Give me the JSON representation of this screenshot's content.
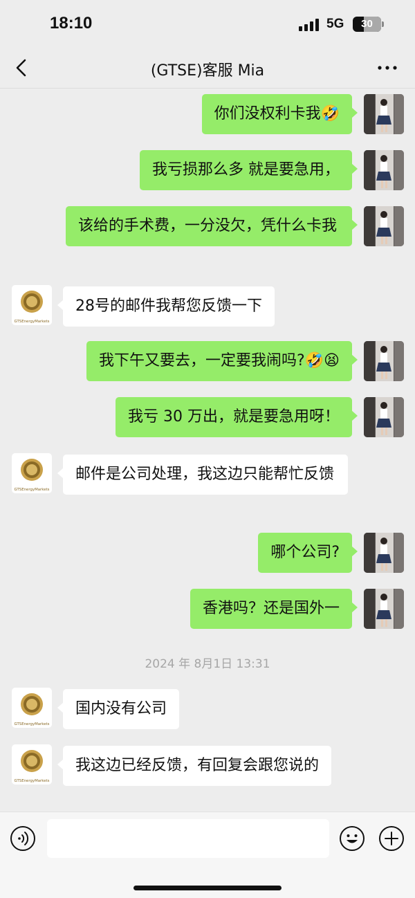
{
  "status_bar": {
    "time": "18:10",
    "network": "5G",
    "battery": "30"
  },
  "header": {
    "title": "(GTSE)客服  Mia",
    "back_icon": "chevron-left-icon",
    "more_icon": "more-dots-icon"
  },
  "brand_caption": "GTSEnergyMarkets",
  "messages": [
    {
      "side": "out",
      "text": "你们没权利卡我🤣"
    },
    {
      "side": "out",
      "text": "我亏损那么多 就是要急用，"
    },
    {
      "side": "out",
      "text": "该给的手术费，一分没欠，凭什么卡我"
    },
    {
      "side": "in",
      "text": "28号的邮件我帮您反馈一下"
    },
    {
      "side": "out",
      "text": "我下午又要去，一定要我闹吗?🤣😫"
    },
    {
      "side": "out",
      "text": "我亏 30 万出，就是要急用呀！"
    },
    {
      "side": "in",
      "text": "邮件是公司处理，我这边只能帮忙反馈"
    },
    {
      "side": "out",
      "text": "哪个公司?"
    },
    {
      "side": "out",
      "text": "香港吗？还是国外一"
    },
    {
      "side": "in",
      "text": "国内没有公司"
    },
    {
      "side": "in",
      "text": "我这边已经反馈，有回复会跟您说的"
    }
  ],
  "timestamp": "2024 年 8月1日 13:31",
  "input_bar": {
    "placeholder": "",
    "voice_icon": "voice-icon",
    "emoji_icon": "emoji-icon",
    "plus_icon": "plus-icon"
  },
  "colors": {
    "out_bubble": "#95ec69",
    "in_bubble": "#ffffff",
    "background": "#ededed",
    "timestamp": "#a6a6a6"
  }
}
